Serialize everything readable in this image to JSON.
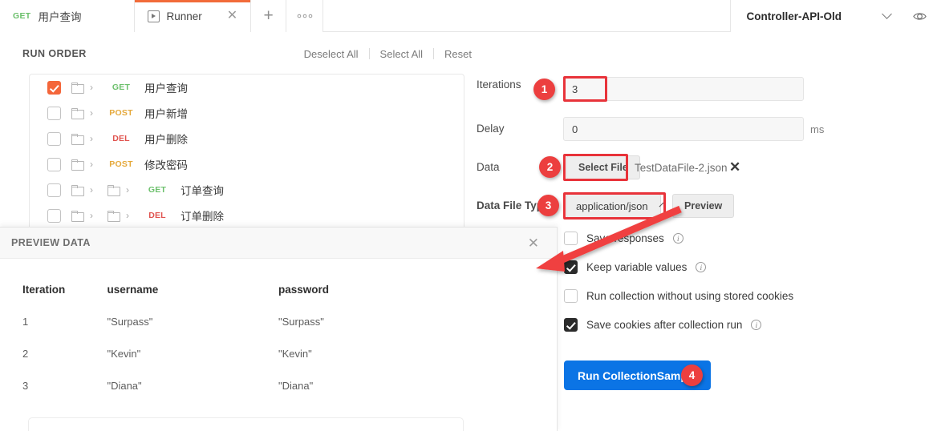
{
  "tabs": [
    {
      "method": "GET",
      "name": "用户查询",
      "active": false,
      "icon": ""
    },
    {
      "method": "",
      "name": "Runner",
      "active": true,
      "icon": "runner-play-icon"
    }
  ],
  "tabbar": {
    "add_label": "+",
    "more_label": "ooo",
    "environment": "Controller-API-Old",
    "eye_icon": "eye-icon",
    "chevron_icon": "chevron-down-icon",
    "close_icon": "close-icon"
  },
  "run_order": {
    "title": "RUN ORDER",
    "actions": [
      "Deselect All",
      "Select All",
      "Reset"
    ],
    "requests": [
      {
        "checked": true,
        "depth": 1,
        "method": "GET",
        "method_class": "m-get",
        "name": "用户查询"
      },
      {
        "checked": false,
        "depth": 1,
        "method": "POST",
        "method_class": "m-post",
        "name": "用户新增"
      },
      {
        "checked": false,
        "depth": 1,
        "method": "DEL",
        "method_class": "m-del",
        "name": "用户删除"
      },
      {
        "checked": false,
        "depth": 1,
        "method": "POST",
        "method_class": "m-post",
        "name": "修改密码"
      },
      {
        "checked": false,
        "depth": 2,
        "method": "GET",
        "method_class": "m-get",
        "name": "订单查询"
      },
      {
        "checked": false,
        "depth": 2,
        "method": "DEL",
        "method_class": "m-del",
        "name": "订单删除"
      }
    ]
  },
  "settings": {
    "iterations_label": "Iterations",
    "iterations_value": "3",
    "delay_label": "Delay",
    "delay_value": "0",
    "delay_unit": "ms",
    "data_label": "Data",
    "select_file_button": "Select File",
    "data_filename": "TestDataFile-2.json",
    "file_clear_icon": "close-icon",
    "data_file_type_label": "Data File Type",
    "data_file_type_value": "application/json",
    "preview_button": "Preview",
    "options": [
      {
        "checked": false,
        "label": "Save responses",
        "info": true
      },
      {
        "checked": true,
        "label": "Keep variable values",
        "info": true
      },
      {
        "checked": false,
        "label": "Run collection without using stored cookies",
        "info": false
      },
      {
        "checked": true,
        "label": "Save cookies after collection run",
        "info": true
      }
    ],
    "run_button": "Run CollectionSample"
  },
  "preview": {
    "title": "PREVIEW DATA",
    "close_icon": "close-icon",
    "columns": [
      "Iteration",
      "username",
      "password"
    ],
    "rows": [
      [
        "1",
        "\"Surpass\"",
        "\"Surpass\""
      ],
      [
        "2",
        "\"Kevin\"",
        "\"Kevin\""
      ],
      [
        "3",
        "\"Diana\"",
        "\"Diana\""
      ]
    ]
  },
  "annotations": {
    "badges": [
      "1",
      "2",
      "3",
      "4"
    ],
    "highlight_color": "#e8333a",
    "badge_color": "#ec3f3f",
    "arrow_color": "#f0403f"
  },
  "colors": {
    "accent_orange": "#f26b3a",
    "run_button_blue": "#0b74e5",
    "get_green": "#6cc06c",
    "post_orange": "#e5a93c",
    "del_red": "#e0534f"
  }
}
